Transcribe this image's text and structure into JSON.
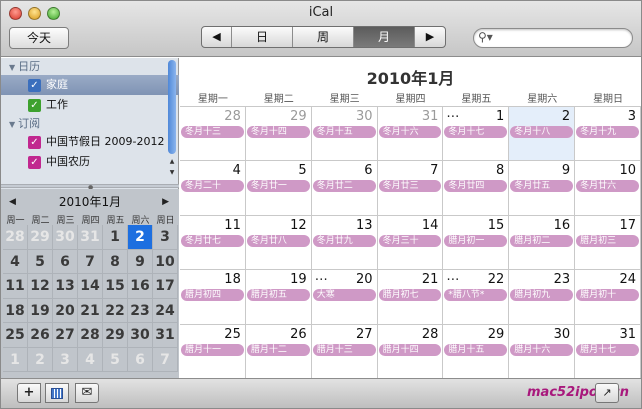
{
  "window": {
    "title": "iCal"
  },
  "toolbar": {
    "today_label": "今天",
    "prev_glyph": "◀",
    "next_glyph": "▶",
    "views": [
      "日",
      "周",
      "月"
    ],
    "active_view": "月",
    "search_icon": "magnifier-dropdown-icon",
    "search_value": ""
  },
  "sidebar": {
    "sections": [
      {
        "label": "日历",
        "items": [
          {
            "label": "家庭",
            "color": "#3b6fbd",
            "checked": true,
            "selected": true
          },
          {
            "label": "工作",
            "color": "#3da12e",
            "checked": true,
            "selected": false
          }
        ]
      },
      {
        "label": "订阅",
        "items": [
          {
            "label": "中国节假日 2009-2012",
            "color": "#c1278f",
            "checked": true,
            "selected": false
          },
          {
            "label": "中国农历",
            "color": "#c1278f",
            "checked": true,
            "selected": false
          }
        ]
      }
    ]
  },
  "mini_calendar": {
    "title": "2010年1月",
    "dows": [
      "周一",
      "周二",
      "周三",
      "周四",
      "周五",
      "周六",
      "周日"
    ],
    "cells": [
      {
        "d": "28",
        "o": true
      },
      {
        "d": "29",
        "o": true
      },
      {
        "d": "30",
        "o": true
      },
      {
        "d": "31",
        "o": true
      },
      {
        "d": "1",
        "o": false
      },
      {
        "d": "2",
        "o": false,
        "sel": true
      },
      {
        "d": "3",
        "o": false
      },
      {
        "d": "4",
        "o": false
      },
      {
        "d": "5",
        "o": false
      },
      {
        "d": "6",
        "o": false
      },
      {
        "d": "7",
        "o": false
      },
      {
        "d": "8",
        "o": false
      },
      {
        "d": "9",
        "o": false
      },
      {
        "d": "10",
        "o": false
      },
      {
        "d": "11",
        "o": false
      },
      {
        "d": "12",
        "o": false
      },
      {
        "d": "13",
        "o": false
      },
      {
        "d": "14",
        "o": false
      },
      {
        "d": "15",
        "o": false
      },
      {
        "d": "16",
        "o": false
      },
      {
        "d": "17",
        "o": false
      },
      {
        "d": "18",
        "o": false
      },
      {
        "d": "19",
        "o": false
      },
      {
        "d": "20",
        "o": false
      },
      {
        "d": "21",
        "o": false
      },
      {
        "d": "22",
        "o": false
      },
      {
        "d": "23",
        "o": false
      },
      {
        "d": "24",
        "o": false
      },
      {
        "d": "25",
        "o": false
      },
      {
        "d": "26",
        "o": false
      },
      {
        "d": "27",
        "o": false
      },
      {
        "d": "28",
        "o": false
      },
      {
        "d": "29",
        "o": false
      },
      {
        "d": "30",
        "o": false
      },
      {
        "d": "31",
        "o": false
      },
      {
        "d": "1",
        "o": true
      },
      {
        "d": "2",
        "o": true
      },
      {
        "d": "3",
        "o": true
      },
      {
        "d": "4",
        "o": true
      },
      {
        "d": "5",
        "o": true
      },
      {
        "d": "6",
        "o": true
      },
      {
        "d": "7",
        "o": true
      }
    ]
  },
  "month_view": {
    "title": "2010年1月",
    "dows": [
      "星期一",
      "星期二",
      "星期三",
      "星期四",
      "星期五",
      "星期六",
      "星期日"
    ],
    "event_color": "#cf99c6",
    "weeks": [
      [
        {
          "d": "28",
          "o": true,
          "ev": "冬月十三"
        },
        {
          "d": "29",
          "o": true,
          "ev": "冬月十四"
        },
        {
          "d": "30",
          "o": true,
          "ev": "冬月十五"
        },
        {
          "d": "31",
          "o": true,
          "ev": "冬月十六"
        },
        {
          "d": "1",
          "ev": "冬月十七",
          "more": "…"
        },
        {
          "d": "2",
          "ev": "冬月十八",
          "today": true
        },
        {
          "d": "3",
          "ev": "冬月十九"
        }
      ],
      [
        {
          "d": "4",
          "ev": "冬月二十"
        },
        {
          "d": "5",
          "ev": "冬月廿一"
        },
        {
          "d": "6",
          "ev": "冬月廿二"
        },
        {
          "d": "7",
          "ev": "冬月廿三"
        },
        {
          "d": "8",
          "ev": "冬月廿四"
        },
        {
          "d": "9",
          "ev": "冬月廿五"
        },
        {
          "d": "10",
          "ev": "冬月廿六"
        }
      ],
      [
        {
          "d": "11",
          "ev": "冬月廿七"
        },
        {
          "d": "12",
          "ev": "冬月廿八"
        },
        {
          "d": "13",
          "ev": "冬月廿九"
        },
        {
          "d": "14",
          "ev": "冬月三十"
        },
        {
          "d": "15",
          "ev": "腊月初一"
        },
        {
          "d": "16",
          "ev": "腊月初二"
        },
        {
          "d": "17",
          "ev": "腊月初三"
        }
      ],
      [
        {
          "d": "18",
          "ev": "腊月初四"
        },
        {
          "d": "19",
          "ev": "腊月初五"
        },
        {
          "d": "20",
          "ev": "大寒",
          "more": "…"
        },
        {
          "d": "21",
          "ev": "腊月初七"
        },
        {
          "d": "22",
          "ev": "*腊八节*",
          "more": "…"
        },
        {
          "d": "23",
          "ev": "腊月初九"
        },
        {
          "d": "24",
          "ev": "腊月初十"
        }
      ],
      [
        {
          "d": "25",
          "ev": "腊月十一"
        },
        {
          "d": "26",
          "ev": "腊月十二"
        },
        {
          "d": "27",
          "ev": "腊月十三"
        },
        {
          "d": "28",
          "ev": "腊月十四"
        },
        {
          "d": "29",
          "ev": "腊月十五"
        },
        {
          "d": "30",
          "ev": "腊月十六"
        },
        {
          "d": "31",
          "ev": "腊月十七"
        }
      ]
    ]
  },
  "bottom": {
    "add_glyph": "+",
    "mini_icon": "mini-calendar-icon",
    "mail_glyph": "✉",
    "right_glyph": "↗",
    "brand": "mac52ipod.cn"
  }
}
